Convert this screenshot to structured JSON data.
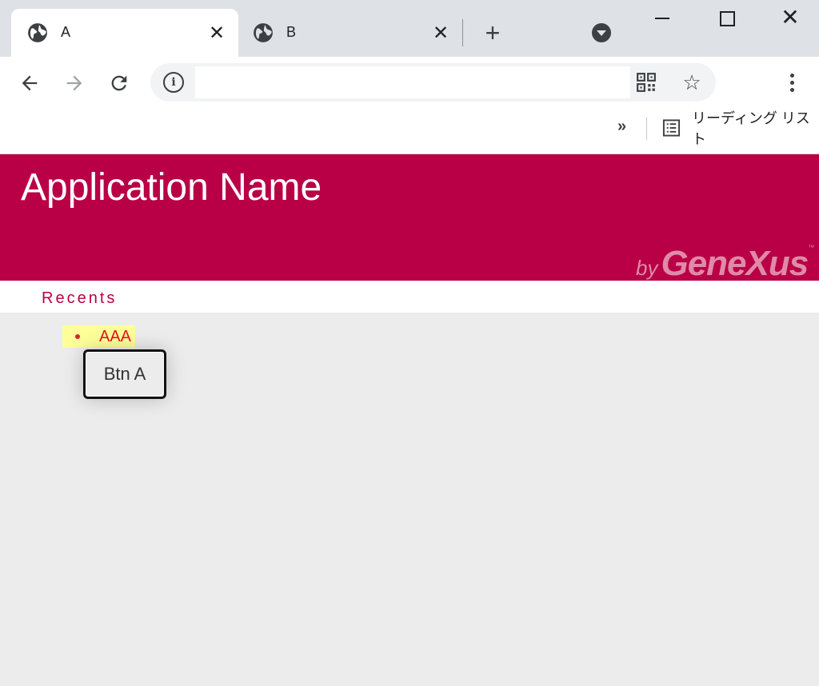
{
  "browser": {
    "tabs": [
      {
        "title": "A",
        "active": true
      },
      {
        "title": "B",
        "active": false
      }
    ],
    "close_glyph": "✕",
    "new_tab_glyph": "+",
    "window_close_glyph": "✕",
    "reading_list_label": "リーディング リスト",
    "bookmarks_overflow_glyph": "»",
    "address_value": "",
    "info_glyph": "i",
    "star_glyph": "☆"
  },
  "app": {
    "title": "Application Name",
    "brand_by": "by",
    "brand_name": "GeneXus",
    "brand_tm": "™",
    "accent_color": "#b90046"
  },
  "recents": {
    "label": "Recents",
    "items": [
      {
        "label": "AAA"
      }
    ]
  },
  "button_a": {
    "label": "Btn A"
  }
}
